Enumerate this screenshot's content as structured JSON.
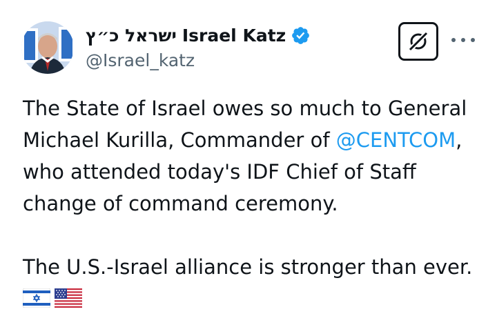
{
  "author": {
    "display_name_hebrew": "ישראל כ״ץ",
    "display_name_english": "Israel Katz",
    "handle": "@Israel_katz",
    "verified": true,
    "avatar_icon": "profile-photo"
  },
  "actions": {
    "grok_icon": "grok-icon",
    "more_icon": "more-dots-icon"
  },
  "tweet": {
    "line1": "The State of Israel owes so much to General",
    "line2_prefix": "Michael Kurilla, Commander of ",
    "mention": "@CENTCOM",
    "line2_suffix": ",",
    "line3": "who attended today's IDF Chief of Staff",
    "line4": "change of command ceremony.",
    "line5": "The U.S.-Israel alliance is stronger than ever.",
    "emojis": [
      "israel-flag",
      "us-flag"
    ]
  },
  "colors": {
    "text": "#0f1419",
    "secondary": "#536471",
    "link": "#1d9bf0",
    "verified": "#1d9bf0"
  }
}
